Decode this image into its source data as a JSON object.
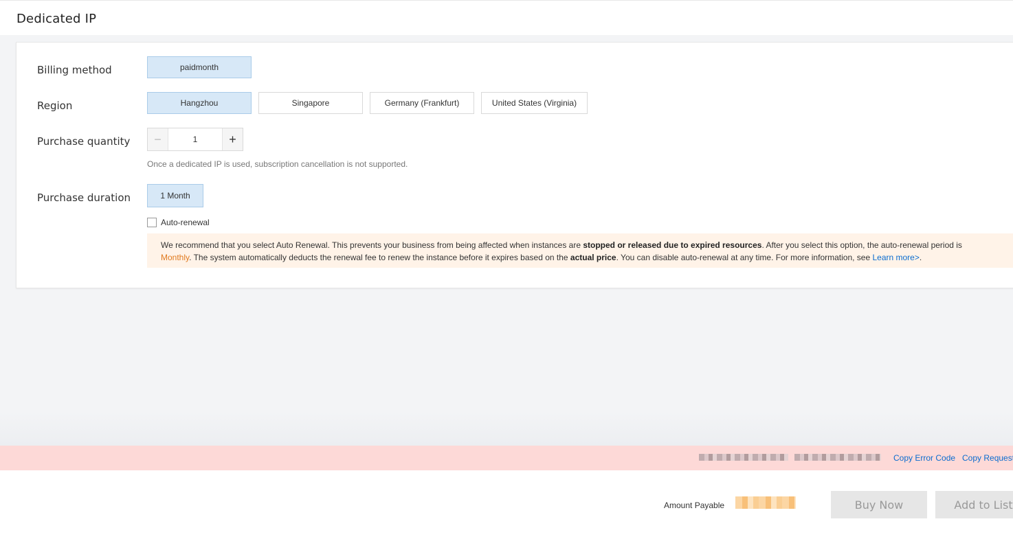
{
  "header": {
    "title": "Dedicated IP"
  },
  "form": {
    "billing": {
      "label": "Billing method",
      "options": [
        "paidmonth"
      ],
      "selected": "paidmonth"
    },
    "region": {
      "label": "Region",
      "options": [
        "Hangzhou",
        "Singapore",
        "Germany (Frankfurt)",
        "United States (Virginia)"
      ],
      "selected": "Hangzhou"
    },
    "quantity": {
      "label": "Purchase quantity",
      "value": "1",
      "minus_symbol": "−",
      "plus_symbol": "+",
      "hint": "Once a dedicated IP is used, subscription cancellation is not supported."
    },
    "duration": {
      "label": "Purchase duration",
      "options": [
        "1 Month"
      ],
      "selected": "1 Month",
      "auto_renewal_label": "Auto-renewal",
      "auto_renewal_checked": false
    },
    "notice": {
      "part1": "We recommend that you select Auto Renewal. This prevents your business from being affected when instances are ",
      "bold1": "stopped or released due to expired resources",
      "part2": ". After you select this option, the auto-renewal period is ",
      "period": "Monthly",
      "part3": ". The system automatically deducts the renewal fee to renew the instance before it expires based on the ",
      "bold2": "actual price",
      "part4": ". You can disable auto-renewal at any time. For more information, see ",
      "link": "Learn more>",
      "part5": "."
    }
  },
  "error_bar": {
    "copy_error_code": "Copy Error Code",
    "copy_request": "Copy Request"
  },
  "footer": {
    "amount_label": "Amount Payable",
    "buy_now": "Buy Now",
    "add_to_list": "Add to List"
  },
  "colors": {
    "selected_option_bg": "#d7e8f7",
    "error_bar_bg": "#fdd9d7",
    "notice_bg": "#fff3e8",
    "link": "#0a6ccf",
    "accent_orange": "#e07a1f"
  }
}
